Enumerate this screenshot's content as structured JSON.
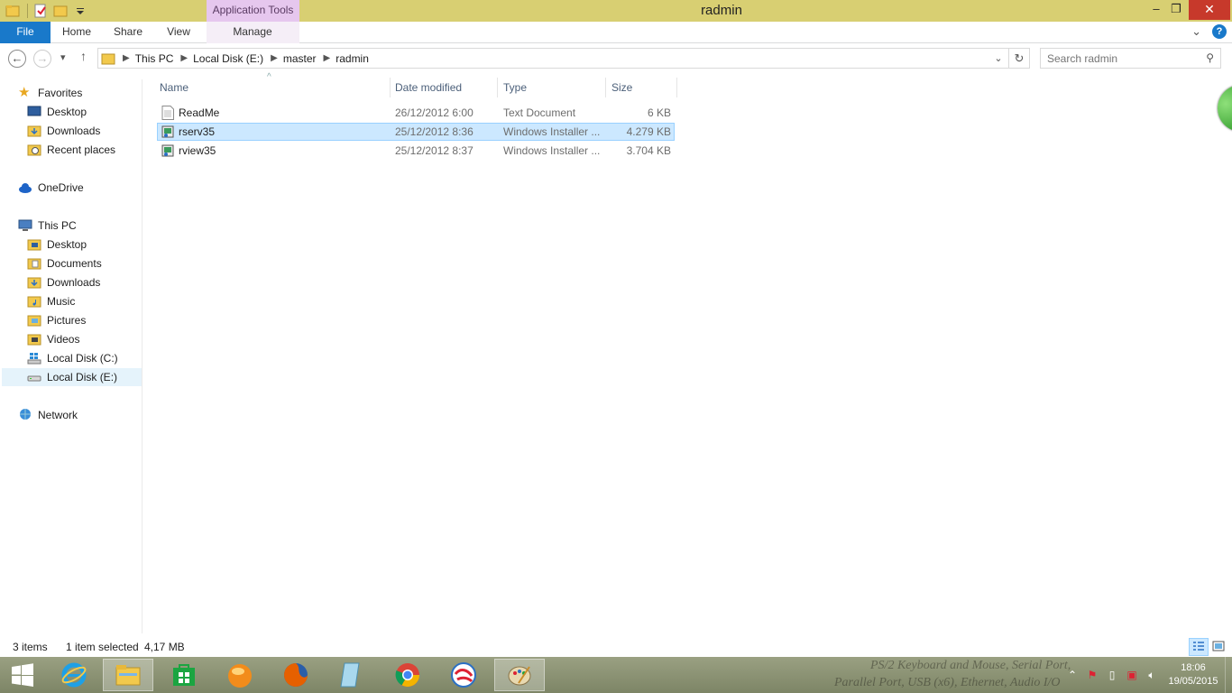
{
  "window": {
    "title": "radmin",
    "contextual_tab_group": "Application Tools",
    "controls": {
      "minimize": "–",
      "maximize": "❐",
      "close": "✕"
    }
  },
  "ribbon": {
    "file": "File",
    "tabs": [
      "Home",
      "Share",
      "View",
      "Manage"
    ],
    "expand_icon": "⌄",
    "help": "?"
  },
  "address": {
    "back": "←",
    "forward": "→",
    "recent": "▾",
    "up": "↑",
    "breadcrumbs": [
      "This PC",
      "Local Disk (E:)",
      "master",
      "radmin"
    ],
    "dropdown": "⌄",
    "refresh": "↻"
  },
  "search": {
    "placeholder": "Search radmin",
    "icon": "⚲"
  },
  "nav": {
    "favorites": "Favorites",
    "fav_items": [
      "Desktop",
      "Downloads",
      "Recent places"
    ],
    "onedrive": "OneDrive",
    "thispc": "This PC",
    "pc_items": [
      "Desktop",
      "Documents",
      "Downloads",
      "Music",
      "Pictures",
      "Videos",
      "Local Disk (C:)",
      "Local Disk (E:)"
    ],
    "network": "Network"
  },
  "columns": {
    "name": "Name",
    "date": "Date modified",
    "type": "Type",
    "size": "Size",
    "sort_indicator": "^"
  },
  "files": [
    {
      "name": "ReadMe",
      "date": "26/12/2012 6:00",
      "type": "Text Document",
      "size": "6 KB",
      "icon": "text-file-icon"
    },
    {
      "name": "rserv35",
      "date": "25/12/2012 8:36",
      "type": "Windows Installer ...",
      "size": "4.279 KB",
      "icon": "installer-icon",
      "selected": true
    },
    {
      "name": "rview35",
      "date": "25/12/2012 8:37",
      "type": "Windows Installer ...",
      "size": "3.704 KB",
      "icon": "installer-icon"
    }
  ],
  "status": {
    "items": "3 items",
    "selected": "1 item selected",
    "size": "4,17 MB"
  },
  "wallpaper_text": [
    "PS/2 Keyboard and Mouse, Serial Port,",
    "Parallel Port, USB (x6), Ethernet, Audio I/O"
  ],
  "taskbar": {
    "apps": [
      "start-icon",
      "internet-explorer-icon",
      "file-explorer-icon",
      "store-icon",
      "orange-ball-app-icon",
      "firefox-icon",
      "notepad-app-icon",
      "chrome-icon",
      "swirl-app-icon",
      "paint-icon"
    ],
    "clock_time": "18:06",
    "clock_date": "19/05/2015"
  },
  "colors": {
    "accent": "#1979ca",
    "titlebar": "#d8cf72",
    "selection": "#cce8ff",
    "context_tab": "#e6c7ee"
  }
}
